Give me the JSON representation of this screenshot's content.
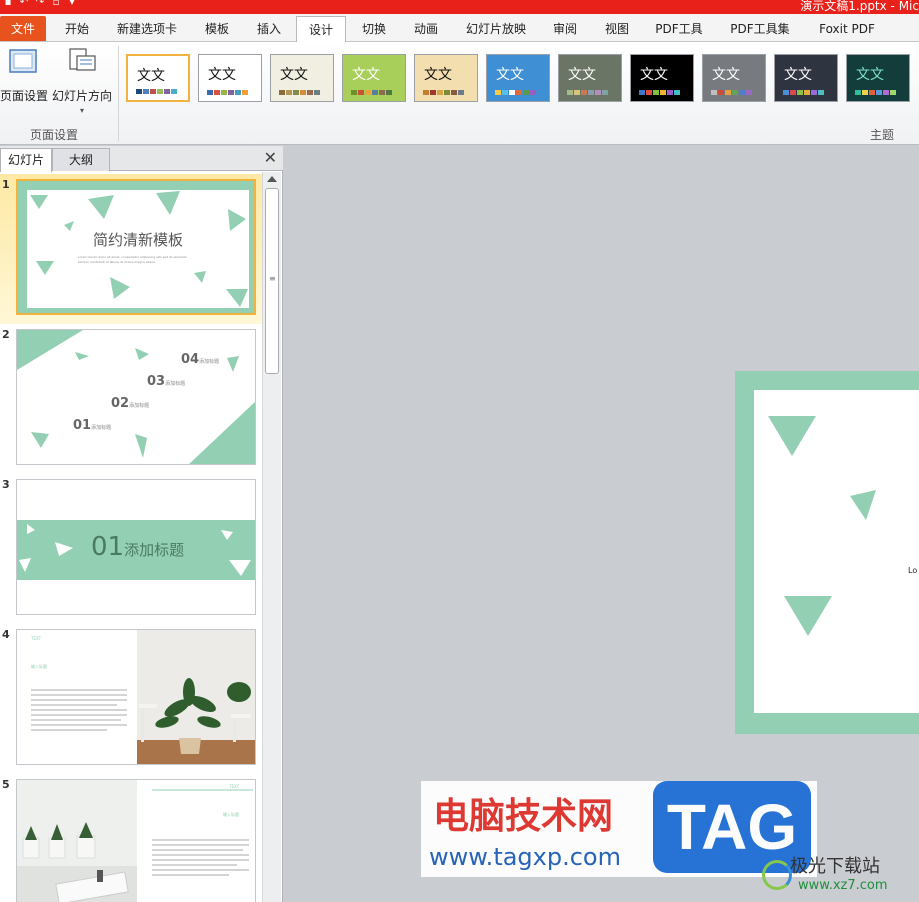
{
  "window": {
    "title": "演示文稿1.pptx - Mic"
  },
  "ribbon_tabs": [
    "文件",
    "开始",
    "新建选项卡",
    "模板",
    "插入",
    "设计",
    "切换",
    "动画",
    "幻灯片放映",
    "审阅",
    "视图",
    "PDF工具",
    "PDF工具集",
    "Foxit PDF"
  ],
  "active_tab": "设计",
  "page_setup_group": {
    "page_setup_label": "页面设置",
    "orientation_label": "幻灯片方向",
    "group_label": "页面设置"
  },
  "themes_group": {
    "group_label": "主题",
    "theme_sample_text": "文文",
    "themes": [
      {
        "bg": "#ffffff",
        "fg": "#111111",
        "swatches": [
          "#1f497d",
          "#4f81bd",
          "#c0504d",
          "#9bbb59",
          "#8064a2",
          "#4bacc6"
        ]
      },
      {
        "bg": "#ffffff",
        "fg": "#111111",
        "swatches": [
          "#3c6bad",
          "#d8523c",
          "#9bb54a",
          "#7f64a2",
          "#43a0bd",
          "#f59d38"
        ]
      },
      {
        "bg": "#f1efe2",
        "fg": "#111111",
        "swatches": [
          "#8a6d3b",
          "#b59552",
          "#7f8c4a",
          "#d48d38",
          "#9c6a4f",
          "#6e7f80"
        ]
      },
      {
        "bg": "#a8cf5a",
        "fg": "#ffffff",
        "swatches": [
          "#6d8f2c",
          "#c6522f",
          "#e6a63d",
          "#587f9a",
          "#8c6b4f",
          "#4f7a48"
        ]
      },
      {
        "bg": "#f3deaf",
        "fg": "#111111",
        "swatches": [
          "#c17f2f",
          "#a0382f",
          "#d9a441",
          "#7c8a3c",
          "#8a5a3c",
          "#6a7c8a"
        ]
      },
      {
        "bg": "#3e8fd4",
        "fg": "#ffffff",
        "swatches": [
          "#f7c948",
          "#55c2e8",
          "#ffffff",
          "#e06a3a",
          "#5b9a48",
          "#9a5bc2"
        ]
      },
      {
        "bg": "#6b7565",
        "fg": "#ffffff",
        "swatches": [
          "#a7b88b",
          "#d9c37a",
          "#c77a4f",
          "#8d9db0",
          "#b58ec0",
          "#7fa3a3"
        ]
      },
      {
        "bg": "#000000",
        "fg": "#ffffff",
        "swatches": [
          "#3d76c9",
          "#e34a3b",
          "#7fbf3f",
          "#f2b234",
          "#9a5ac9",
          "#3fbfbf"
        ]
      },
      {
        "bg": "#777b80",
        "fg": "#ffffff",
        "swatches": [
          "#bfbfbf",
          "#c94d3b",
          "#e6a13d",
          "#5fa35f",
          "#4f7fc9",
          "#9a6ac2"
        ]
      },
      {
        "bg": "#2e3440",
        "fg": "#ffffff",
        "swatches": [
          "#4a90d9",
          "#d94a4a",
          "#8fc04a",
          "#e0b03d",
          "#9a6ad9",
          "#4ac0c0"
        ]
      },
      {
        "bg": "#123d3a",
        "fg": "#7fe3c8",
        "swatches": [
          "#2fbf9f",
          "#f2d24a",
          "#e0603d",
          "#5a9ad9",
          "#b06ad9",
          "#9fd96a"
        ]
      }
    ]
  },
  "slides_pane": {
    "tab_slides": "幻灯片",
    "tab_outline": "大纲",
    "close_glyph": "✕"
  },
  "slides": [
    {
      "number": "1",
      "title": "简约清新模板",
      "subtitle_line1": "Lorem ipsum dolor sit amet, consectetur adipiscing elit, sed do eiusmod",
      "subtitle_line2": "tempor incididunt ut labore et dolore magna aliqua."
    },
    {
      "number": "2",
      "items": [
        {
          "num": "01",
          "label": "添加标题"
        },
        {
          "num": "02",
          "label": "添加标题"
        },
        {
          "num": "03",
          "label": "添加标题"
        },
        {
          "num": "04",
          "label": "添加标题"
        }
      ]
    },
    {
      "number": "3",
      "num": "01",
      "title": "添加标题"
    },
    {
      "number": "4",
      "tag": "TEXT",
      "heading": "输入标题"
    },
    {
      "number": "5",
      "tag": "TEXT",
      "heading": "输入标题"
    }
  ],
  "main_slide": {
    "partial_text": "Lo"
  },
  "colors": {
    "accent": "#93cfb2",
    "file_tab": "#e8531d",
    "titlebar": "#e8211a"
  },
  "watermark": {
    "site_name": "电脑技术网",
    "url": "www.tagxp.com",
    "tag": "TAG",
    "secondary_name": "极光下载站",
    "secondary_url": "www.xz7.com"
  }
}
